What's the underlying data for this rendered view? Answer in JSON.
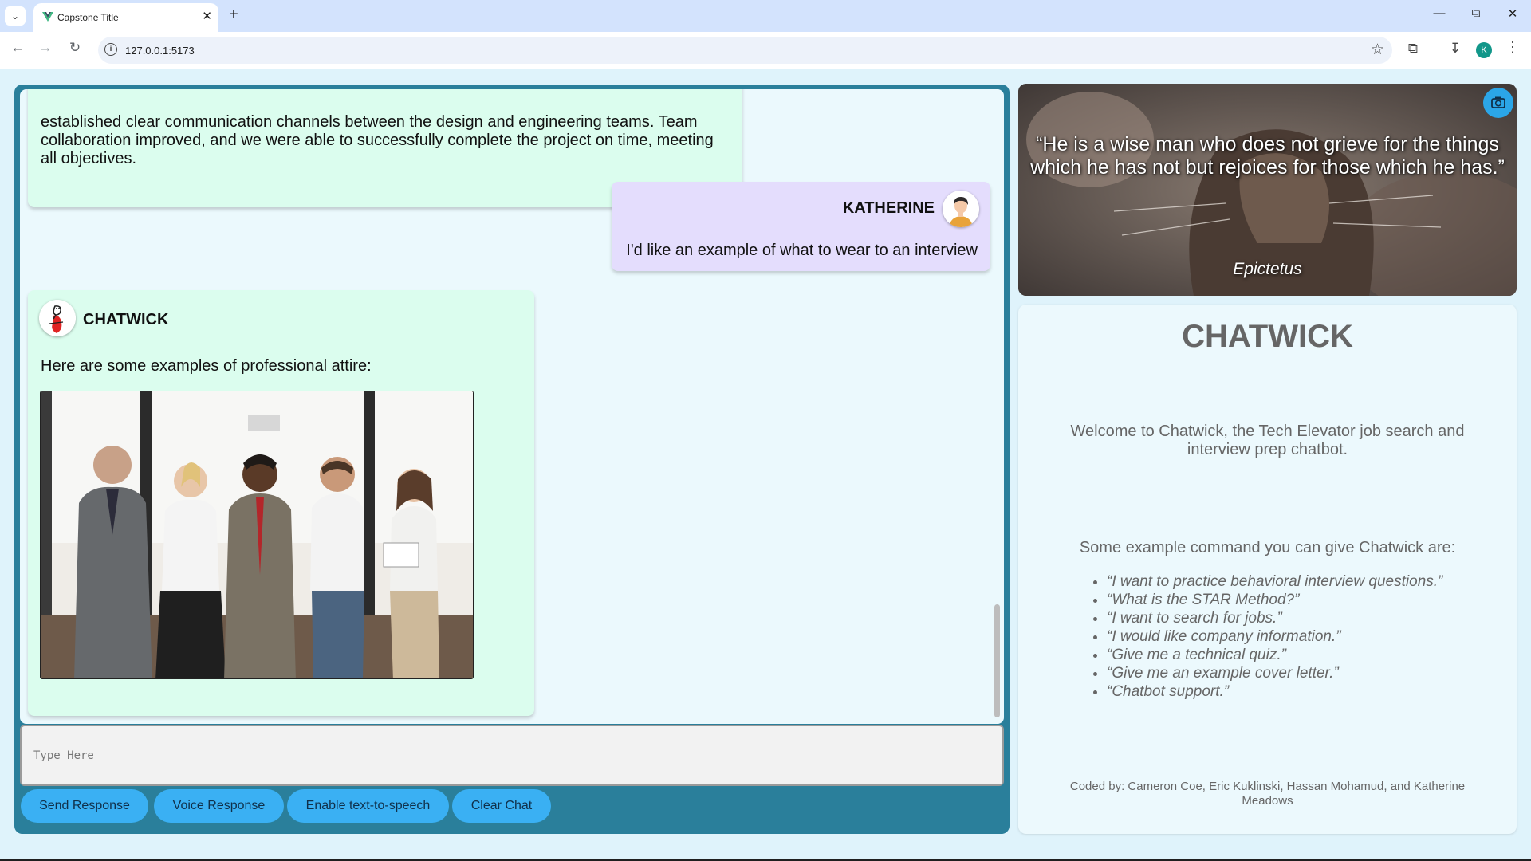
{
  "browser": {
    "tab_title": "Capstone Title",
    "url": "127.0.0.1:5173",
    "profile_initial": "K"
  },
  "chat": {
    "messages": [
      {
        "sender": "",
        "text": "established clear communication channels between the design and engineering teams. Team collaboration improved, and we were able to successfully complete the project on time, meeting all objectives."
      },
      {
        "sender": "KATHERINE",
        "text": "I'd like an example of what to wear to an interview"
      },
      {
        "sender": "CHATWICK",
        "text": "Here are some examples of professional attire:"
      }
    ],
    "input_placeholder": "Type Here",
    "buttons": {
      "send": "Send Response",
      "voice": "Voice Response",
      "tts": "Enable text-to-speech",
      "clear": "Clear Chat"
    }
  },
  "quote": {
    "text": "“He is a wise man who does not grieve for the things which he has not but rejoices for those which he has.”",
    "author": "Epictetus"
  },
  "info": {
    "title": "CHATWICK",
    "welcome": "Welcome to Chatwick, the Tech Elevator job search and interview prep chatbot.",
    "examples_heading": "Some example command you can give Chatwick are:",
    "examples": [
      "“I want to practice behavioral interview questions.”",
      "“What is the STAR Method?”",
      "“I want to search for jobs.”",
      "“I would like company information.”",
      "“Give me a technical quiz.”",
      "“Give me an example cover letter.”",
      "“Chatbot support.”"
    ],
    "credits": "Coded by: Cameron Coe, Eric Kuklinski, Hassan Mohamud, and Katherine Meadows"
  },
  "colors": {
    "panel": "#2a7f9b",
    "chat_bg": "#ebf9fd",
    "bot_bubble": "#dbfdee",
    "user_bubble": "#e4ddfd",
    "button": "#3ab0f3",
    "info_text": "#666666"
  },
  "icons": {
    "tab_list": "chevron-down-icon",
    "favicon": "vue-logo-icon",
    "tab_close": "close-icon",
    "new_tab": "plus-icon",
    "back": "arrow-left-icon",
    "forward": "arrow-right-icon",
    "reload": "reload-icon",
    "site_info": "info-icon",
    "bookmark": "star-icon",
    "extensions": "puzzle-icon",
    "downloads": "download-icon",
    "menu": "kebab-menu-icon",
    "screenshot": "camera-icon"
  }
}
